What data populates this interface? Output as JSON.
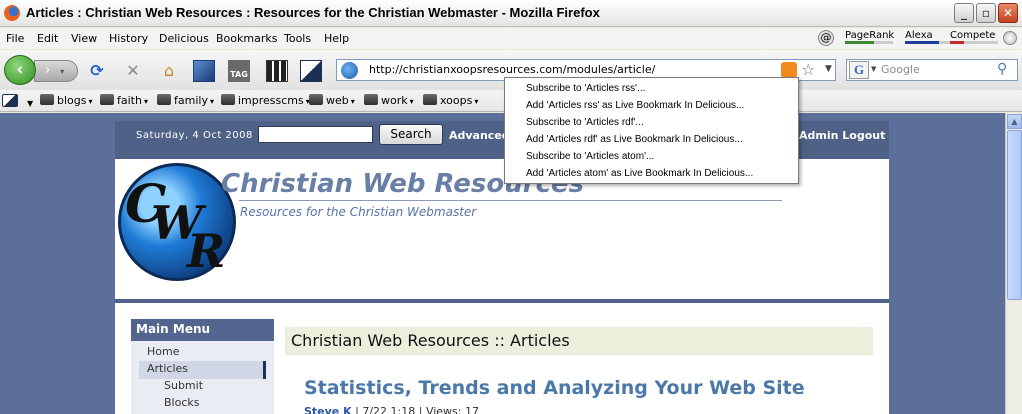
{
  "window": {
    "title": "Articles : Christian Web Resources : Resources for the Christian Webmaster - Mozilla Firefox"
  },
  "menu": {
    "items": [
      "File",
      "Edit",
      "View",
      "History",
      "Delicious",
      "Bookmarks",
      "Tools",
      "Help"
    ],
    "addons": [
      {
        "label": "PageRank",
        "level": 0.6,
        "color": "#3b8a2e"
      },
      {
        "label": "Alexa",
        "level": 0.7,
        "color": "#1d3f9b"
      },
      {
        "label": "Compete",
        "level": 0.3,
        "color": "#c02a2a"
      }
    ]
  },
  "toolbar": {
    "url": "http://christianxoopsresources.com/modules/article/",
    "search_placeholder": "Google",
    "icons": [
      "back-icon",
      "forward-icon",
      "reload-icon",
      "stop-icon",
      "home-icon",
      "bookmark-icon",
      "tag-icon",
      "screengrab-icon",
      "contrast-icon"
    ]
  },
  "bookmarks": {
    "items": [
      "blogs",
      "faith",
      "family",
      "impresscms",
      "web",
      "work",
      "xoops"
    ]
  },
  "site": {
    "date": "Saturday, 4 Oct 2008",
    "search_button": "Search",
    "advanced_label": "Advanced",
    "admin_label": "Admin Logout",
    "title": "Christian Web Resources",
    "subtitle": "Resources for the Christian Webmaster",
    "logo_letters": [
      "C",
      "W",
      "R"
    ]
  },
  "sidebar": {
    "heading": "Main Menu",
    "items": [
      "Home",
      "Articles",
      "Submit",
      "Blocks"
    ]
  },
  "main": {
    "heading": "Christian Web Resources :: Articles",
    "article_title": "Statistics, Trends and Analyzing Your Web Site",
    "article_author": "Steve K",
    "article_meta": "| 7/22 1:18 | Views: 17"
  },
  "feed_menu": {
    "options": [
      "Subscribe to 'Articles rss'...",
      "Add 'Articles rss' as Live Bookmark In Delicious...",
      "Subscribe to 'Articles rdf'...",
      "Add 'Articles rdf' as Live Bookmark In Delicious...",
      "Subscribe to 'Articles atom'...",
      "Add 'Articles atom' as Live Bookmark In Delicious..."
    ]
  }
}
